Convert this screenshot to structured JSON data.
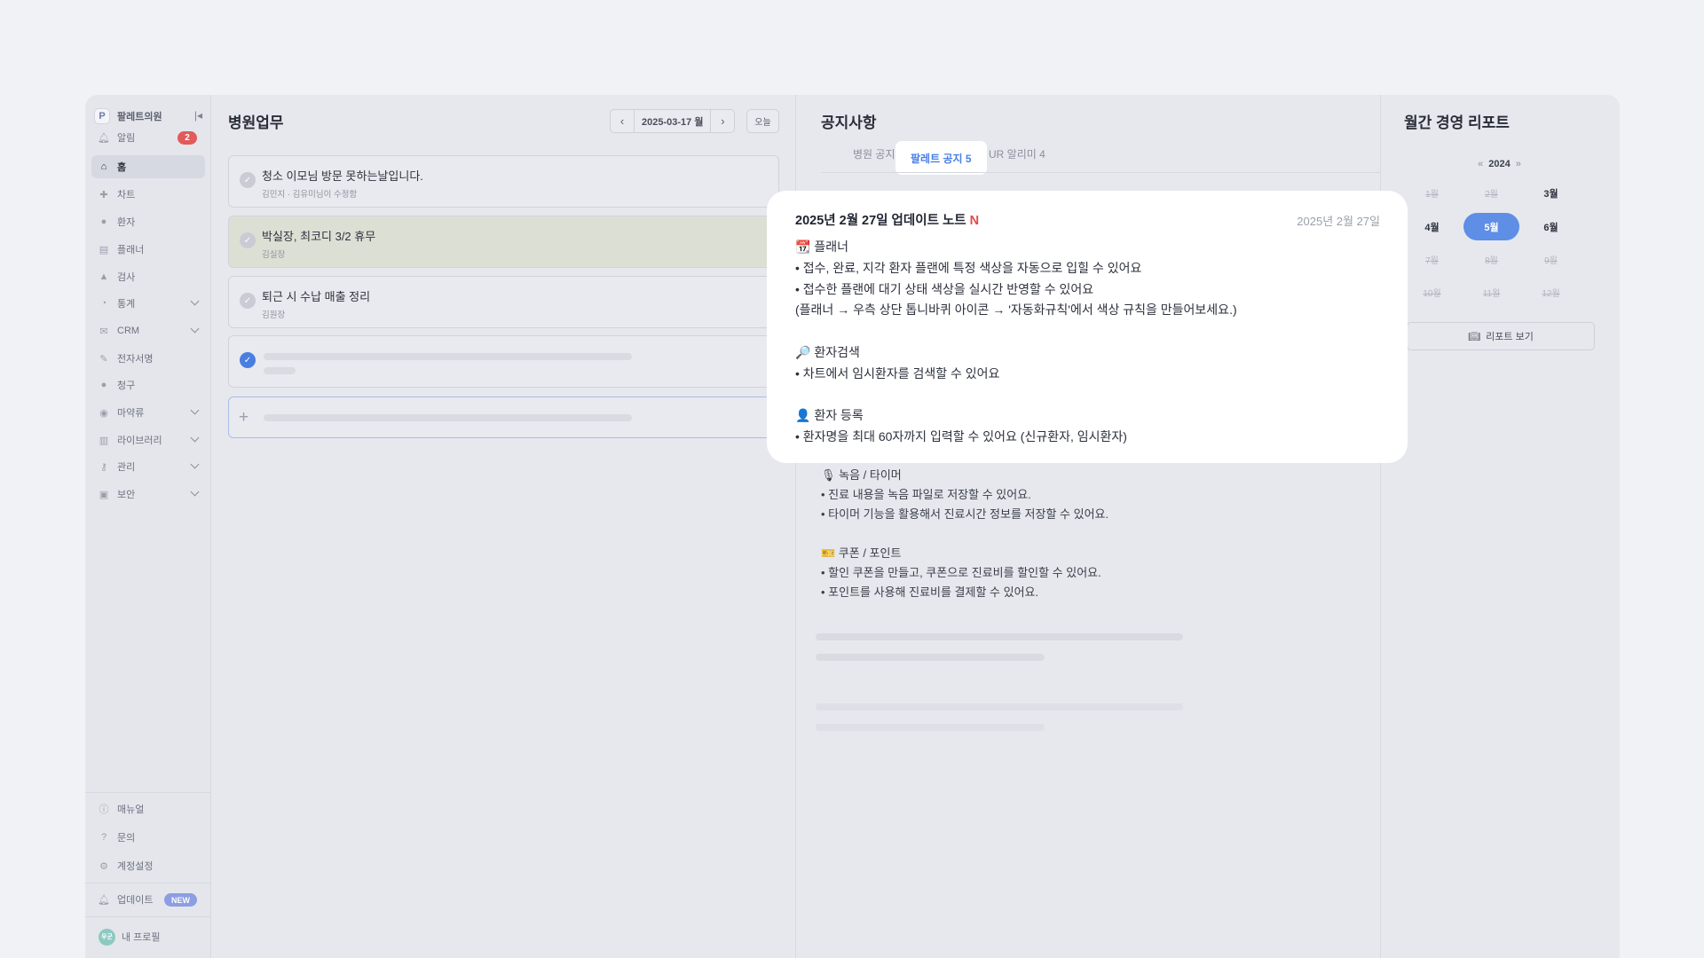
{
  "sidebar": {
    "brand": "팔레트의원",
    "brand_logo": "P",
    "items": [
      {
        "label": "알림",
        "icon": "bell-icon",
        "badge": "2"
      },
      {
        "label": "홈",
        "icon": "home-icon",
        "active": true
      },
      {
        "label": "차트",
        "icon": "chart-cross-icon"
      },
      {
        "label": "환자",
        "icon": "person-icon"
      },
      {
        "label": "플래너",
        "icon": "planner-icon"
      },
      {
        "label": "검사",
        "icon": "flask-icon"
      },
      {
        "label": "통계",
        "icon": "stats-icon",
        "expandable": true
      },
      {
        "label": "CRM",
        "icon": "mail-icon",
        "expandable": true
      },
      {
        "label": "전자서명",
        "icon": "signature-icon"
      },
      {
        "label": "청구",
        "icon": "claim-icon"
      },
      {
        "label": "마약류",
        "icon": "pill-icon",
        "expandable": true
      },
      {
        "label": "라이브러리",
        "icon": "book-icon",
        "expandable": true
      },
      {
        "label": "관리",
        "icon": "key-icon",
        "expandable": true
      },
      {
        "label": "보안",
        "icon": "lock-icon",
        "expandable": true
      }
    ],
    "bottom": [
      {
        "label": "매뉴얼",
        "icon": "info-icon"
      },
      {
        "label": "문의",
        "icon": "question-icon"
      },
      {
        "label": "계정설정",
        "icon": "gear-icon"
      },
      {
        "label": "업데이트",
        "icon": "bell-update-icon",
        "badge": "NEW"
      }
    ],
    "profile": {
      "label": "내 프로필",
      "avatar": "우군"
    }
  },
  "tasks": {
    "title": "병원업무",
    "date": "2025-03-17 월",
    "today_label": "오늘",
    "items": [
      {
        "title": "청소 이모님 방문 못하는날입니다.",
        "sub": "김민지 · 김유미님이 수정함"
      },
      {
        "title": "박실장, 최코디 3/2 휴무",
        "sub": "김실장"
      },
      {
        "title": "퇴근 시 수납 매출 정리",
        "sub": "김원장"
      }
    ]
  },
  "notice": {
    "title": "공지사항",
    "tabs": [
      "병원 공지",
      "팔레트 공지 5",
      "UR 알리미 4"
    ],
    "body": [
      "🎙 녹음 / 타이머",
      "• 진료 내용을 녹음 파일로 저장할 수 있어요.",
      "• 타이머 기능을 활용해서 진료시간 정보를 저장할 수 있어요.",
      "🎫 쿠폰 / 포인트",
      "• 할인 쿠폰을 만들고, 쿠폰으로 진료비를 할인할 수 있어요.",
      "• 포인트를 사용해 진료비를 결제할 수 있어요."
    ]
  },
  "report": {
    "title": "월간 경영 리포트",
    "year": "2024",
    "prev": "«",
    "next": "»",
    "months": [
      {
        "label": "1월",
        "state": "disabled"
      },
      {
        "label": "2월",
        "state": "disabled"
      },
      {
        "label": "3월",
        "state": "enabled"
      },
      {
        "label": "4월",
        "state": "enabled"
      },
      {
        "label": "5월",
        "state": "selected"
      },
      {
        "label": "6월",
        "state": "enabled"
      },
      {
        "label": "7월",
        "state": "disabled"
      },
      {
        "label": "8월",
        "state": "disabled"
      },
      {
        "label": "9월",
        "state": "disabled"
      },
      {
        "label": "10월",
        "state": "disabled"
      },
      {
        "label": "11월",
        "state": "disabled"
      },
      {
        "label": "12월",
        "state": "disabled"
      }
    ],
    "button": "리포트 보기"
  },
  "popup": {
    "title": "2025년 2월 27일 업데이트 노트",
    "new_mark": "N",
    "date": "2025년 2월 27일",
    "lines": [
      "📆 플래너",
      "• 접수, 완료, 지각 환자 플랜에 특정 색상을 자동으로 입힐 수 있어요",
      "• 접수한 플랜에 대기 상태 색상을 실시간 반영할 수 있어요",
      "(플래너 → 우측 상단 톱니바퀴 아이콘 → '자동화규칙'에서 색상 규칙을 만들어보세요.)",
      "🔎 환자검색",
      "• 차트에서 임시환자를 검색할 수 있어요",
      "👤 환자 등록",
      "• 환자명을 최대 60자까지 입력할 수 있어요 (신규환자, 임시환자)"
    ]
  },
  "colors": {
    "accent": "#4a80e5",
    "badge_red": "#e25a5a",
    "new_badge": "#8c9ee2",
    "selected_month": "#5e8ee6"
  }
}
